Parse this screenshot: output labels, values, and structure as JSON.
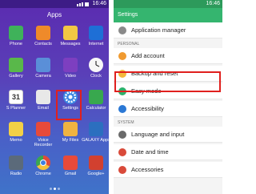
{
  "left": {
    "title": "Apps",
    "status_time": "16:46",
    "apps": [
      {
        "label": "Phone",
        "color": "#3fb25a"
      },
      {
        "label": "Contacts",
        "color": "#ef8a2a"
      },
      {
        "label": "Messages",
        "color": "#f2c744"
      },
      {
        "label": "Internet",
        "color": "#1e6fd6"
      },
      {
        "label": "Gallery",
        "color": "#59b84a"
      },
      {
        "label": "Camera",
        "color": "#5a8fd8"
      },
      {
        "label": "Video",
        "color": "#7d3fc0"
      },
      {
        "label": "Clock",
        "color": "#f7f7f7"
      },
      {
        "label": "S Planner",
        "color": "#ffffff"
      },
      {
        "label": "Email",
        "color": "#e8e8e8"
      },
      {
        "label": "Settings",
        "color": "#3b86e2"
      },
      {
        "label": "Calculator",
        "color": "#38a84e"
      },
      {
        "label": "Memo",
        "color": "#f3d046"
      },
      {
        "label": "Voice Recorder",
        "color": "#e74a3a"
      },
      {
        "label": "My Files",
        "color": "#f0b341"
      },
      {
        "label": "GALAXY Apps",
        "color": "#2c6fbf"
      },
      {
        "label": "Radio",
        "color": "#5b6a7a"
      },
      {
        "label": "Chrome",
        "color": "#f2f2f2"
      },
      {
        "label": "Gmail",
        "color": "#e84a3a"
      },
      {
        "label": "Google+",
        "color": "#d2402f"
      }
    ],
    "s_planner_day": "31"
  },
  "right": {
    "title": "Settings",
    "status_time": "16:46",
    "rows": [
      {
        "label": "Application manager",
        "icon": "app-manager-icon",
        "color": "#8a8a8a"
      },
      {
        "section": "PERSONAL"
      },
      {
        "label": "Add account",
        "icon": "add-account-icon",
        "color": "#f09a30"
      },
      {
        "label": "Backup and reset",
        "icon": "backup-reset-icon",
        "color": "#f4b73b"
      },
      {
        "label": "Easy mode",
        "icon": "easy-mode-icon",
        "color": "#2db06a"
      },
      {
        "label": "Accessibility",
        "icon": "accessibility-icon",
        "color": "#2b78d5"
      },
      {
        "section": "SYSTEM"
      },
      {
        "label": "Language and input",
        "icon": "language-icon",
        "color": "#6a6a6a"
      },
      {
        "label": "Date and time",
        "icon": "date-time-icon",
        "color": "#d94a3a"
      },
      {
        "label": "Accessories",
        "icon": "accessories-icon",
        "color": "#d94a3a"
      }
    ]
  }
}
